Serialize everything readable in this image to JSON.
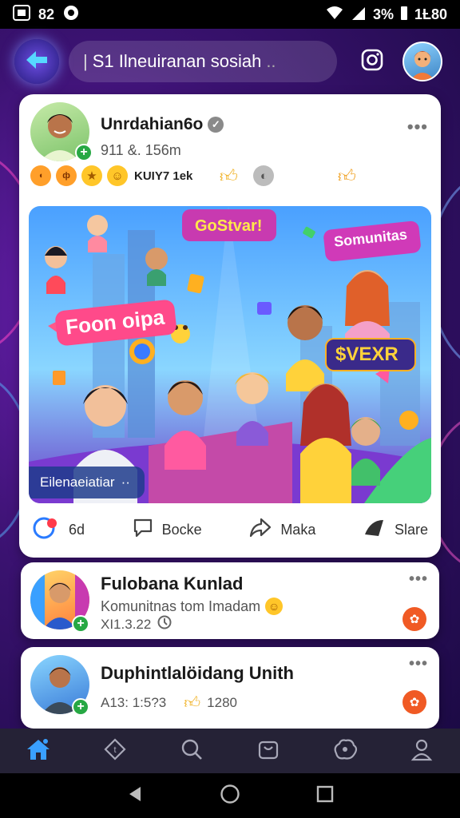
{
  "status_bar": {
    "sim_label": "82",
    "battery": "3%",
    "time": "1Ƚ80"
  },
  "top_bar": {
    "search_text": "S1 Ilneuiranan sosiah",
    "search_suffix": "..",
    "icons": [
      "back-arrow-icon",
      "instagram-icon",
      "avatar"
    ]
  },
  "post": {
    "author": "Unrdahian6o",
    "time": "911 &. 156m",
    "reaction_label": "KUIY7 1ek",
    "image": {
      "sign_top": "GoStvar!",
      "sign_left": "Foon oipa",
      "sign_right": "Somunitas",
      "sign_mid": "$VEXR",
      "caption": "Eilenaeiatiar",
      "caption_dots": "··"
    },
    "actions": [
      {
        "icon": "comment-bubble-icon",
        "label": "6d"
      },
      {
        "icon": "chat-icon",
        "label": "Bocke"
      },
      {
        "icon": "share-arrow-icon",
        "label": "Maka"
      },
      {
        "icon": "send-icon",
        "label": "Slare"
      }
    ]
  },
  "list_items": [
    {
      "title": "Fulobana Kunlad",
      "subtitle": "Komunitnas tom Imadam",
      "meta": "XI1.3.22"
    },
    {
      "title": "Duphintlalöidang Unith",
      "meta": "A13: 1:5?3",
      "count": "1280"
    }
  ],
  "bottom_nav": [
    "home-icon",
    "tag-icon",
    "search-icon",
    "shop-bag-icon",
    "community-icon",
    "profile-icon"
  ],
  "colors": {
    "accent": "#6a1fb0",
    "nav_bg": "#252236",
    "active": "#3aa0ff",
    "badge": "#f05a24"
  }
}
